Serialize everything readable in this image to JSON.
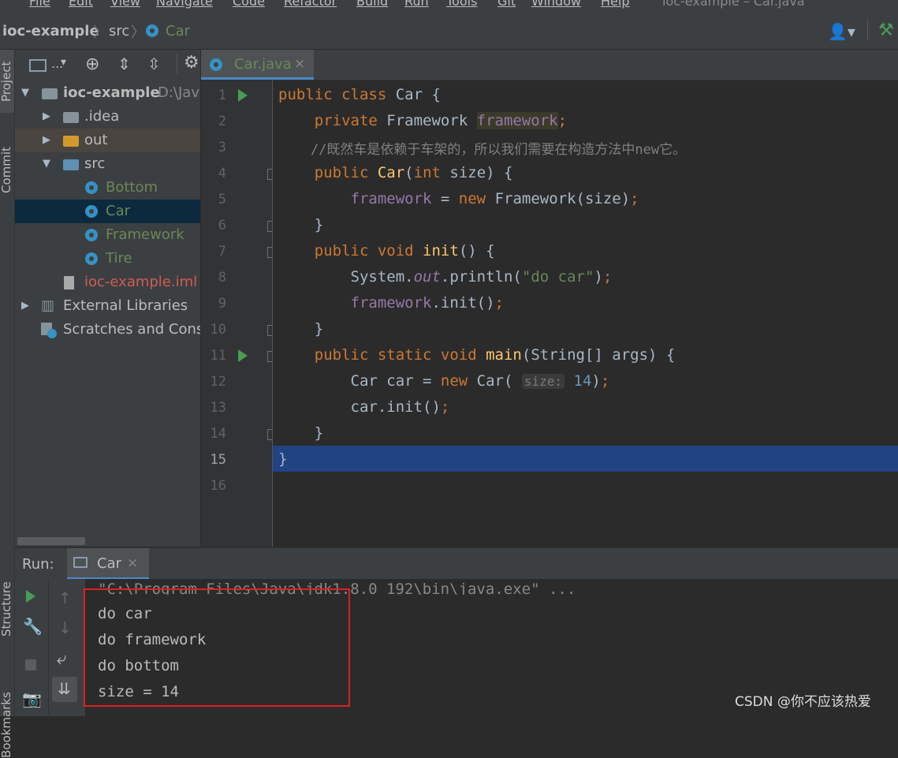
{
  "menu": [
    "File",
    "Edit",
    "View",
    "Navigate",
    "Code",
    "Refactor",
    "Build",
    "Run",
    "Tools",
    "Git",
    "Window",
    "Help"
  ],
  "window_title": "ioc-example – Car.java",
  "breadcrumb": {
    "project": "ioc-example",
    "src": "src",
    "file": "Car"
  },
  "side_tabs": {
    "project": "Project",
    "commit": "Commit",
    "structure": "Structure",
    "bookmarks": "Bookmarks"
  },
  "project_toolbar": {
    "view_label": "..."
  },
  "tree": {
    "root": {
      "name": "ioc-example",
      "path": "D:\\Java"
    },
    "idea": ".idea",
    "out": "out",
    "src": "src",
    "classes": [
      "Bottom",
      "Car",
      "Framework",
      "Tire"
    ],
    "iml": "ioc-example.iml",
    "external": "External Libraries",
    "scratches": "Scratches and Consoles"
  },
  "editor_tab": {
    "label": "Car.java",
    "close": "×"
  },
  "code": {
    "line_numbers": [
      "1",
      "2",
      "3",
      "4",
      "5",
      "6",
      "7",
      "8",
      "9",
      "10",
      "11",
      "12",
      "13",
      "14",
      "15",
      "16"
    ],
    "comment": "//既然车是依赖于车架的，所以我们需要在构造方法中new它。",
    "param_hint": "size:"
  },
  "run": {
    "label": "Run:",
    "tab": "Car",
    "close": "×",
    "command": "\"C:\\Program Files\\Java\\jdk1.8.0_192\\bin\\java.exe\" ...",
    "output": [
      "do car",
      "do framework",
      "do bottom",
      "size = 14"
    ]
  },
  "watermark": "CSDN @你不应该热爱",
  "colors": {
    "accent_blue": "#4a88c7",
    "run_green": "#499c54",
    "highlight_box": "#e02020",
    "selected_line": "#214283"
  }
}
